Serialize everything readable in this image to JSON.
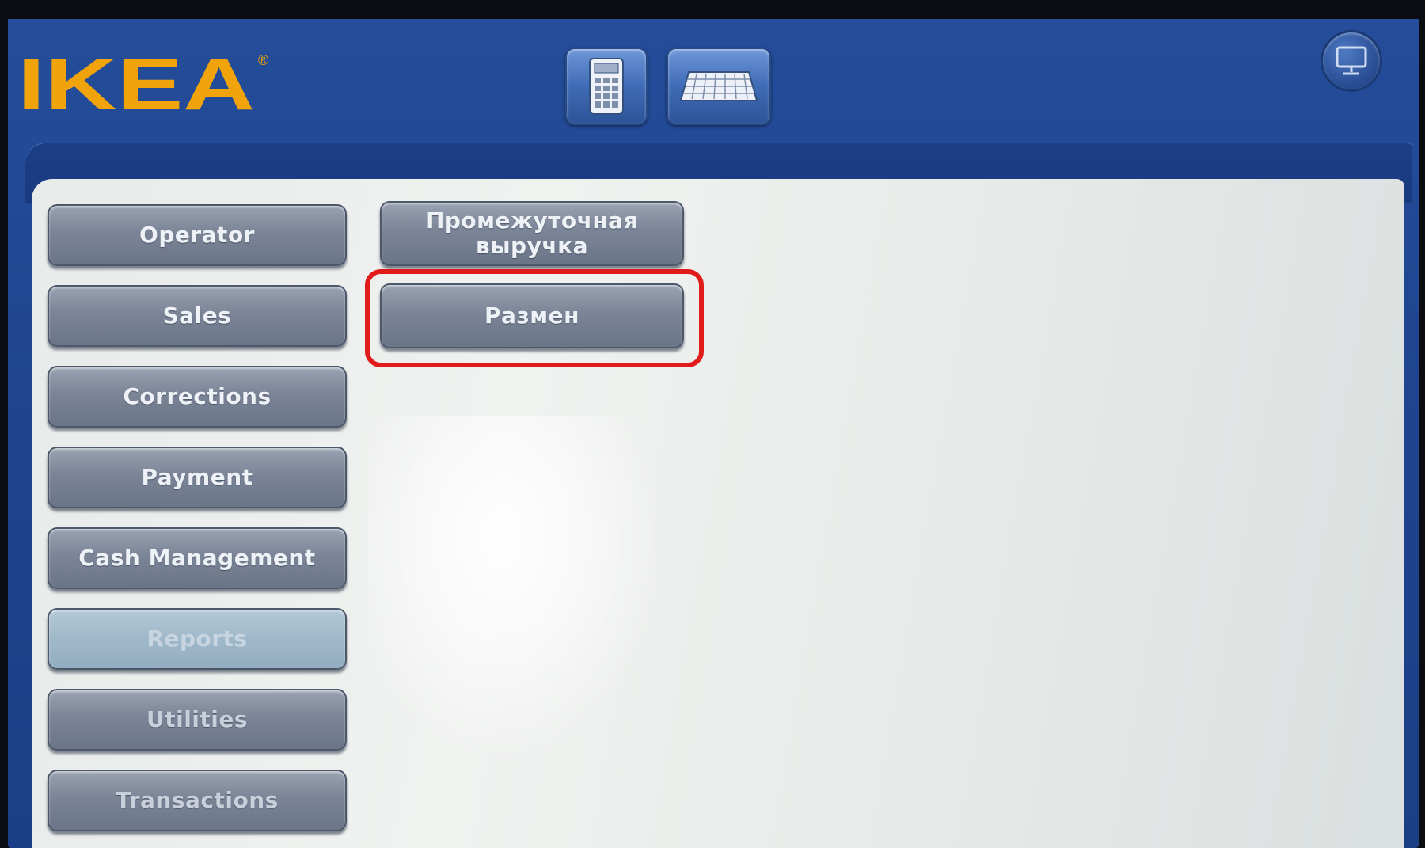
{
  "brand": {
    "logo_text": "IKEA",
    "registered_mark": "®",
    "color": "#f0a30a"
  },
  "toolbar": {
    "calculator_icon": "calculator-icon",
    "keyboard_icon": "keyboard-icon",
    "screen_icon": "monitor-icon"
  },
  "sidebar": {
    "items": [
      {
        "label": "Operator"
      },
      {
        "label": "Sales"
      },
      {
        "label": "Corrections"
      },
      {
        "label": "Payment"
      },
      {
        "label": "Cash Management"
      },
      {
        "label": "Reports",
        "active": true
      },
      {
        "label": "Utilities"
      },
      {
        "label": "Transactions"
      }
    ]
  },
  "submenu": {
    "items": [
      {
        "label_line1": "Промежуточная",
        "label_line2": "выручка"
      },
      {
        "label": "Размен",
        "highlighted": true
      }
    ]
  },
  "colors": {
    "background_blue": "#1f4590",
    "button_gray": "#7b8597",
    "active_button": "#9fb8c9",
    "highlight_red": "#e11a1a"
  }
}
